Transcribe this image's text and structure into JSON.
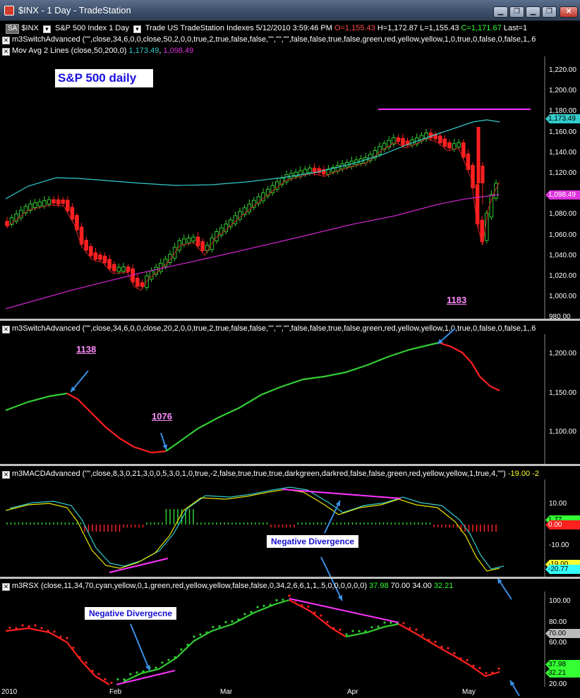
{
  "window": {
    "title": "$INX - 1 Day - TradeStation",
    "min": "▁",
    "restore": "❐",
    "close": "✕",
    "cmin": "▁",
    "crestore": "❐",
    "cclose": "✕"
  },
  "statusbar": {
    "sa": "SA",
    "symbol": "$INX",
    "desc": "S&P 500 Index  1 Day",
    "source": "Trade  US  TradeStation  Indexes  5/12/2010  3:59:46 PM",
    "o": "O=1,155.43",
    "h": "H=1,172.87",
    "l": "L=1,155.43",
    "c": "C=1,171.67",
    "last": "Last=1"
  },
  "price_panel": {
    "label1": "m3SwitchAdvanced  (\"\",close,34,6,0,0,close,50,2,0,0,true,2,true,false,false,\"\",\"\",\"\",false,false,true,false,green,red,yellow,yellow,1,0,true,0,false,0,false,1,.6",
    "label2": "Mov Avg 2 Lines  (close,50,200,0)",
    "ma1": "1,173.49",
    "ma2": "1,098.49",
    "title_box": "S&P 500 daily",
    "annot_1183": "1183"
  },
  "switch_panel": {
    "label": "m3SwitchAdvanced  (\"\",close,34,6,0,0,close,20,2,0,0,true,2,true,false,false,\"\",\"\",\"\",false,false,true,false,green,red,yellow,yellow,1,0,true,0,false,0,false,1,.6",
    "annot_1138": "1138",
    "annot_1076": "1076"
  },
  "macd_panel": {
    "label": "m3MACDAdvanced  (\"\",close,8,3,0,21,3,0,0,5,3,0,1,0,true,-2,false,true,true,true,darkgreen,darkred,false,false,green,red,yellow,yellow,1,true,4,\"\")",
    "v1": "-19.00",
    "v2": "-2",
    "neg_div": "Negative Divergence",
    "b1": "1.77",
    "b2": "0.00",
    "b3": "-19.00",
    "b4": "-20.77"
  },
  "rsx_panel": {
    "label": "m3RSX  (close,11,34,70,cyan,yellow,0,1,green,red,yellow,yellow,false,false,0,34,2,6,6,1,1,.5,0,0,0,0,0,0)",
    "v1": "37.98",
    "v2": "70.00",
    "v3": "34.00",
    "v4": "32.21",
    "neg_div": "Negative Divergecne",
    "b1": "70.00",
    "b2": "37.98",
    "b3": "32.21"
  },
  "yaxis_price": [
    "1,220.00",
    "1,200.00",
    "1,180.00",
    "1,160.00",
    "1,140.00",
    "1,120.00",
    "1,100.00",
    "1,080.00",
    "1,060.00",
    "1,040.00",
    "1,020.00",
    "1,000.00",
    "980.00"
  ],
  "yaxis_switch": [
    "1,200.00",
    "1,150.00",
    "1,100.00"
  ],
  "yaxis_macd": [
    "10.00",
    "-10.00"
  ],
  "yaxis_rsx": [
    "100.00",
    "80.00",
    "60.00",
    "40.00",
    "20.00"
  ],
  "xaxis": [
    "2010",
    "Feb",
    "Mar",
    "Apr",
    "May"
  ],
  "colors": {
    "up": "#33cc33",
    "down": "#ff2020",
    "ma50": "#33cccc",
    "ma200": "#cc22cc",
    "magenta": "#ff33ff",
    "arrow": "#3a8fe8"
  }
}
